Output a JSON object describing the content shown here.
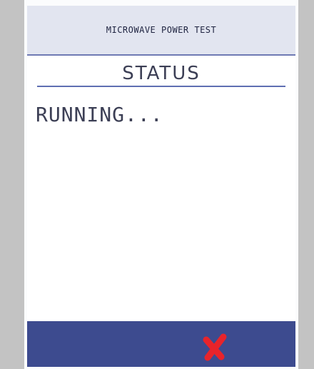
{
  "header": {
    "title": "MICROWAVE POWER TEST"
  },
  "status": {
    "heading": "STATUS",
    "text": "RUNNING..."
  },
  "footer": {
    "cancel_icon": "close-x-icon",
    "cancel_color": "#e8242b"
  },
  "colors": {
    "bezel": "#c3c3c3",
    "header_bg": "#e2e5f0",
    "accent": "#5f6fb2",
    "footer_bg": "#3d4b8f",
    "text": "#3c3f55"
  }
}
